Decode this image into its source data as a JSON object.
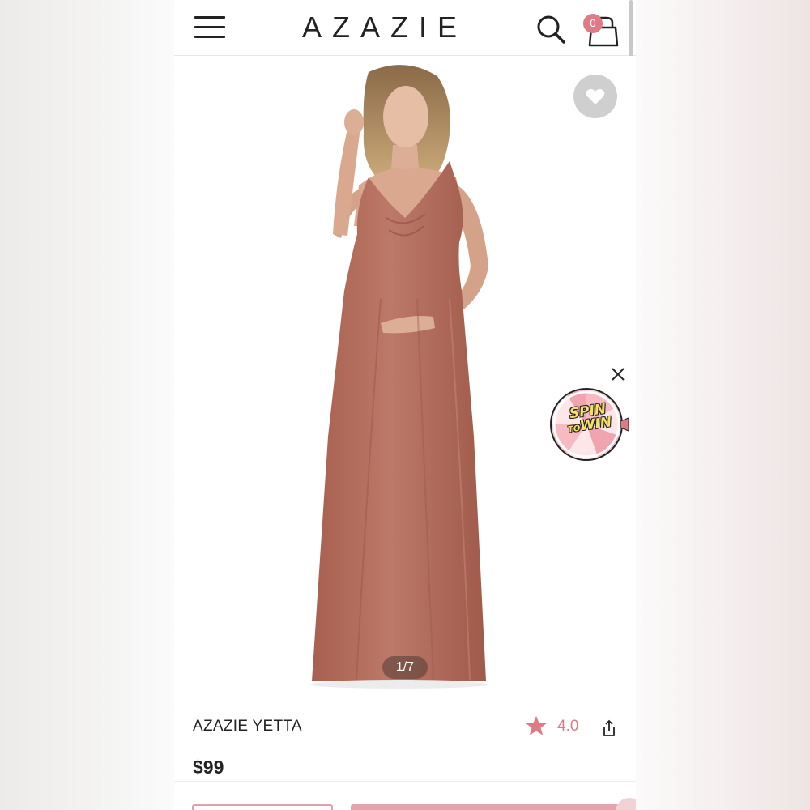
{
  "header": {
    "logo": "AZAZIE",
    "cart_count": "0",
    "menu_icon": "hamburger-menu-icon",
    "search_icon": "search-icon",
    "bag_icon": "shopping-bag-icon"
  },
  "gallery": {
    "image_counter": "1/7",
    "image_alt": "Model wearing a sleeveless V-neck maternity maxi dress in a dusty rose / terracotta color",
    "dress_color": "#b4705f",
    "favorite_icon": "heart-icon"
  },
  "promo": {
    "spin_line1": "SPIN",
    "spin_to": "TO",
    "spin_win": "WIN",
    "close_icon": "close-icon"
  },
  "product": {
    "title": "AZAZIE YETTA",
    "rating": "4.0",
    "price": "$99",
    "star_icon": "star-icon",
    "share_icon": "share-icon"
  },
  "colors": {
    "accent": "#e07b86",
    "text": "#222222"
  }
}
